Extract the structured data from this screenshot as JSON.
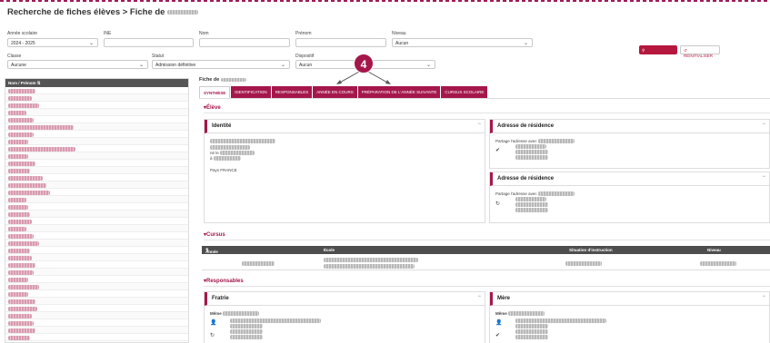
{
  "page": {
    "title": "Recherche de fiches élèves > Fiche de"
  },
  "filters": {
    "annee_label": "Année scolaire",
    "annee_value": "2024 - 2025",
    "ine_label": "INE",
    "nom_label": "Nom",
    "prenom_label": "Prénom",
    "niveau_label": "Niveau",
    "niveau_value": "Aucun",
    "classe_label": "Classe",
    "classe_value": "Aucune",
    "statut_label": "Statut",
    "statut_value": "Admission définitive",
    "dispositif_label": "Dispositif",
    "dispositif_value": "Aucun",
    "search_label": "RECHERCHER",
    "reset_label": "RÉINITIALISER"
  },
  "list": {
    "header": "Nom / Prénom"
  },
  "fiche": {
    "title": "Fiche de",
    "tabs": [
      {
        "label": "SYNTHÈSE",
        "active": true
      },
      {
        "label": "IDENTIFICATION",
        "active": false
      },
      {
        "label": "RESPONSABLES",
        "active": false
      },
      {
        "label": "ANNÉE EN COURS",
        "active": false
      },
      {
        "label": "PRÉPARATION DE L'ANNÉE SUIVANTE",
        "active": false
      },
      {
        "label": "CURSUS SCOLAIRE",
        "active": false
      }
    ],
    "callout": "4"
  },
  "eleve": {
    "section": "Élève",
    "identite_title": "Identité",
    "ne_le": "né le",
    "a": "à",
    "pays": "Pays FRANCE",
    "adresse_title": "Adresse de résidence",
    "adresse_title_2": "Adresse de résidence",
    "partage": "Partage l'adresse avec"
  },
  "cursus": {
    "section": "Cursus",
    "columns": [
      "Année scolaire",
      "École",
      "Situation d'instruction",
      "Niveau"
    ]
  },
  "responsables": {
    "section": "Responsables",
    "fratrie_title": "Fratrie",
    "mere_title": "Mère",
    "meme_label": "Même"
  },
  "colors": {
    "accent": "#a5174b",
    "button": "#b5173e",
    "header_dark": "#4e4e4e"
  }
}
